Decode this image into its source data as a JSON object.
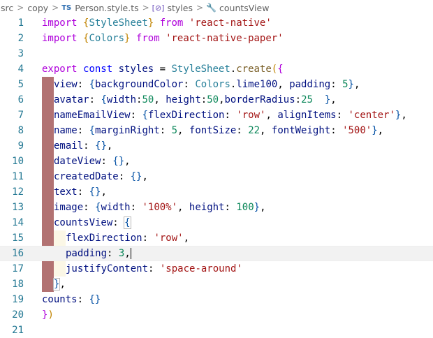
{
  "breadcrumb": {
    "items": [
      "src",
      "copy",
      "Person.style.ts",
      "styles",
      "countsView"
    ],
    "file_badge": "TS",
    "separator": ">"
  },
  "editor": {
    "line_numbers": [
      "1",
      "2",
      "3",
      "4",
      "5",
      "6",
      "7",
      "8",
      "9",
      "10",
      "11",
      "12",
      "13",
      "14",
      "15",
      "16",
      "17",
      "18",
      "19",
      "20",
      "21"
    ],
    "current_line": 16,
    "colors": {
      "keyword": "#0000ff",
      "control_keyword": "#af00db",
      "type": "#267f99",
      "string": "#a31515",
      "number": "#098658",
      "property": "#001080",
      "function": "#795e26",
      "line_number": "#237893",
      "indent_highlight": "#b27272"
    }
  },
  "tokens": {
    "import": "import",
    "from": "from",
    "StyleSheet": "StyleSheet",
    "Colors": "Colors",
    "react_native": "'react-native'",
    "react_native_paper": "'react-native-paper'",
    "export": "export",
    "const": "const",
    "styles": "styles",
    "create": "create",
    "view": "view",
    "backgroundColor": "backgroundColor",
    "lime100": "lime100",
    "padding": "padding",
    "avatar": "avatar",
    "width": "width",
    "height": "height",
    "borderRadius": "borderRadius",
    "nameEmailView": "nameEmailView",
    "flexDirection": "flexDirection",
    "row": "'row'",
    "alignItems": "alignItems",
    "center": "'center'",
    "name": "name",
    "marginRight": "marginRight",
    "fontSize": "fontSize",
    "fontWeight": "fontWeight",
    "w500": "'500'",
    "email": "email",
    "dateView": "dateView",
    "createdDate": "createdDate",
    "text": "text",
    "image": "image",
    "pct100": "'100%'",
    "countsView": "countsView",
    "justifyContent": "justifyContent",
    "spaceAround": "'space-around'",
    "counts": "counts",
    "n5": "5",
    "n50": "50",
    "n25": "25",
    "n22": "22",
    "n100": "100",
    "n3": "3"
  }
}
